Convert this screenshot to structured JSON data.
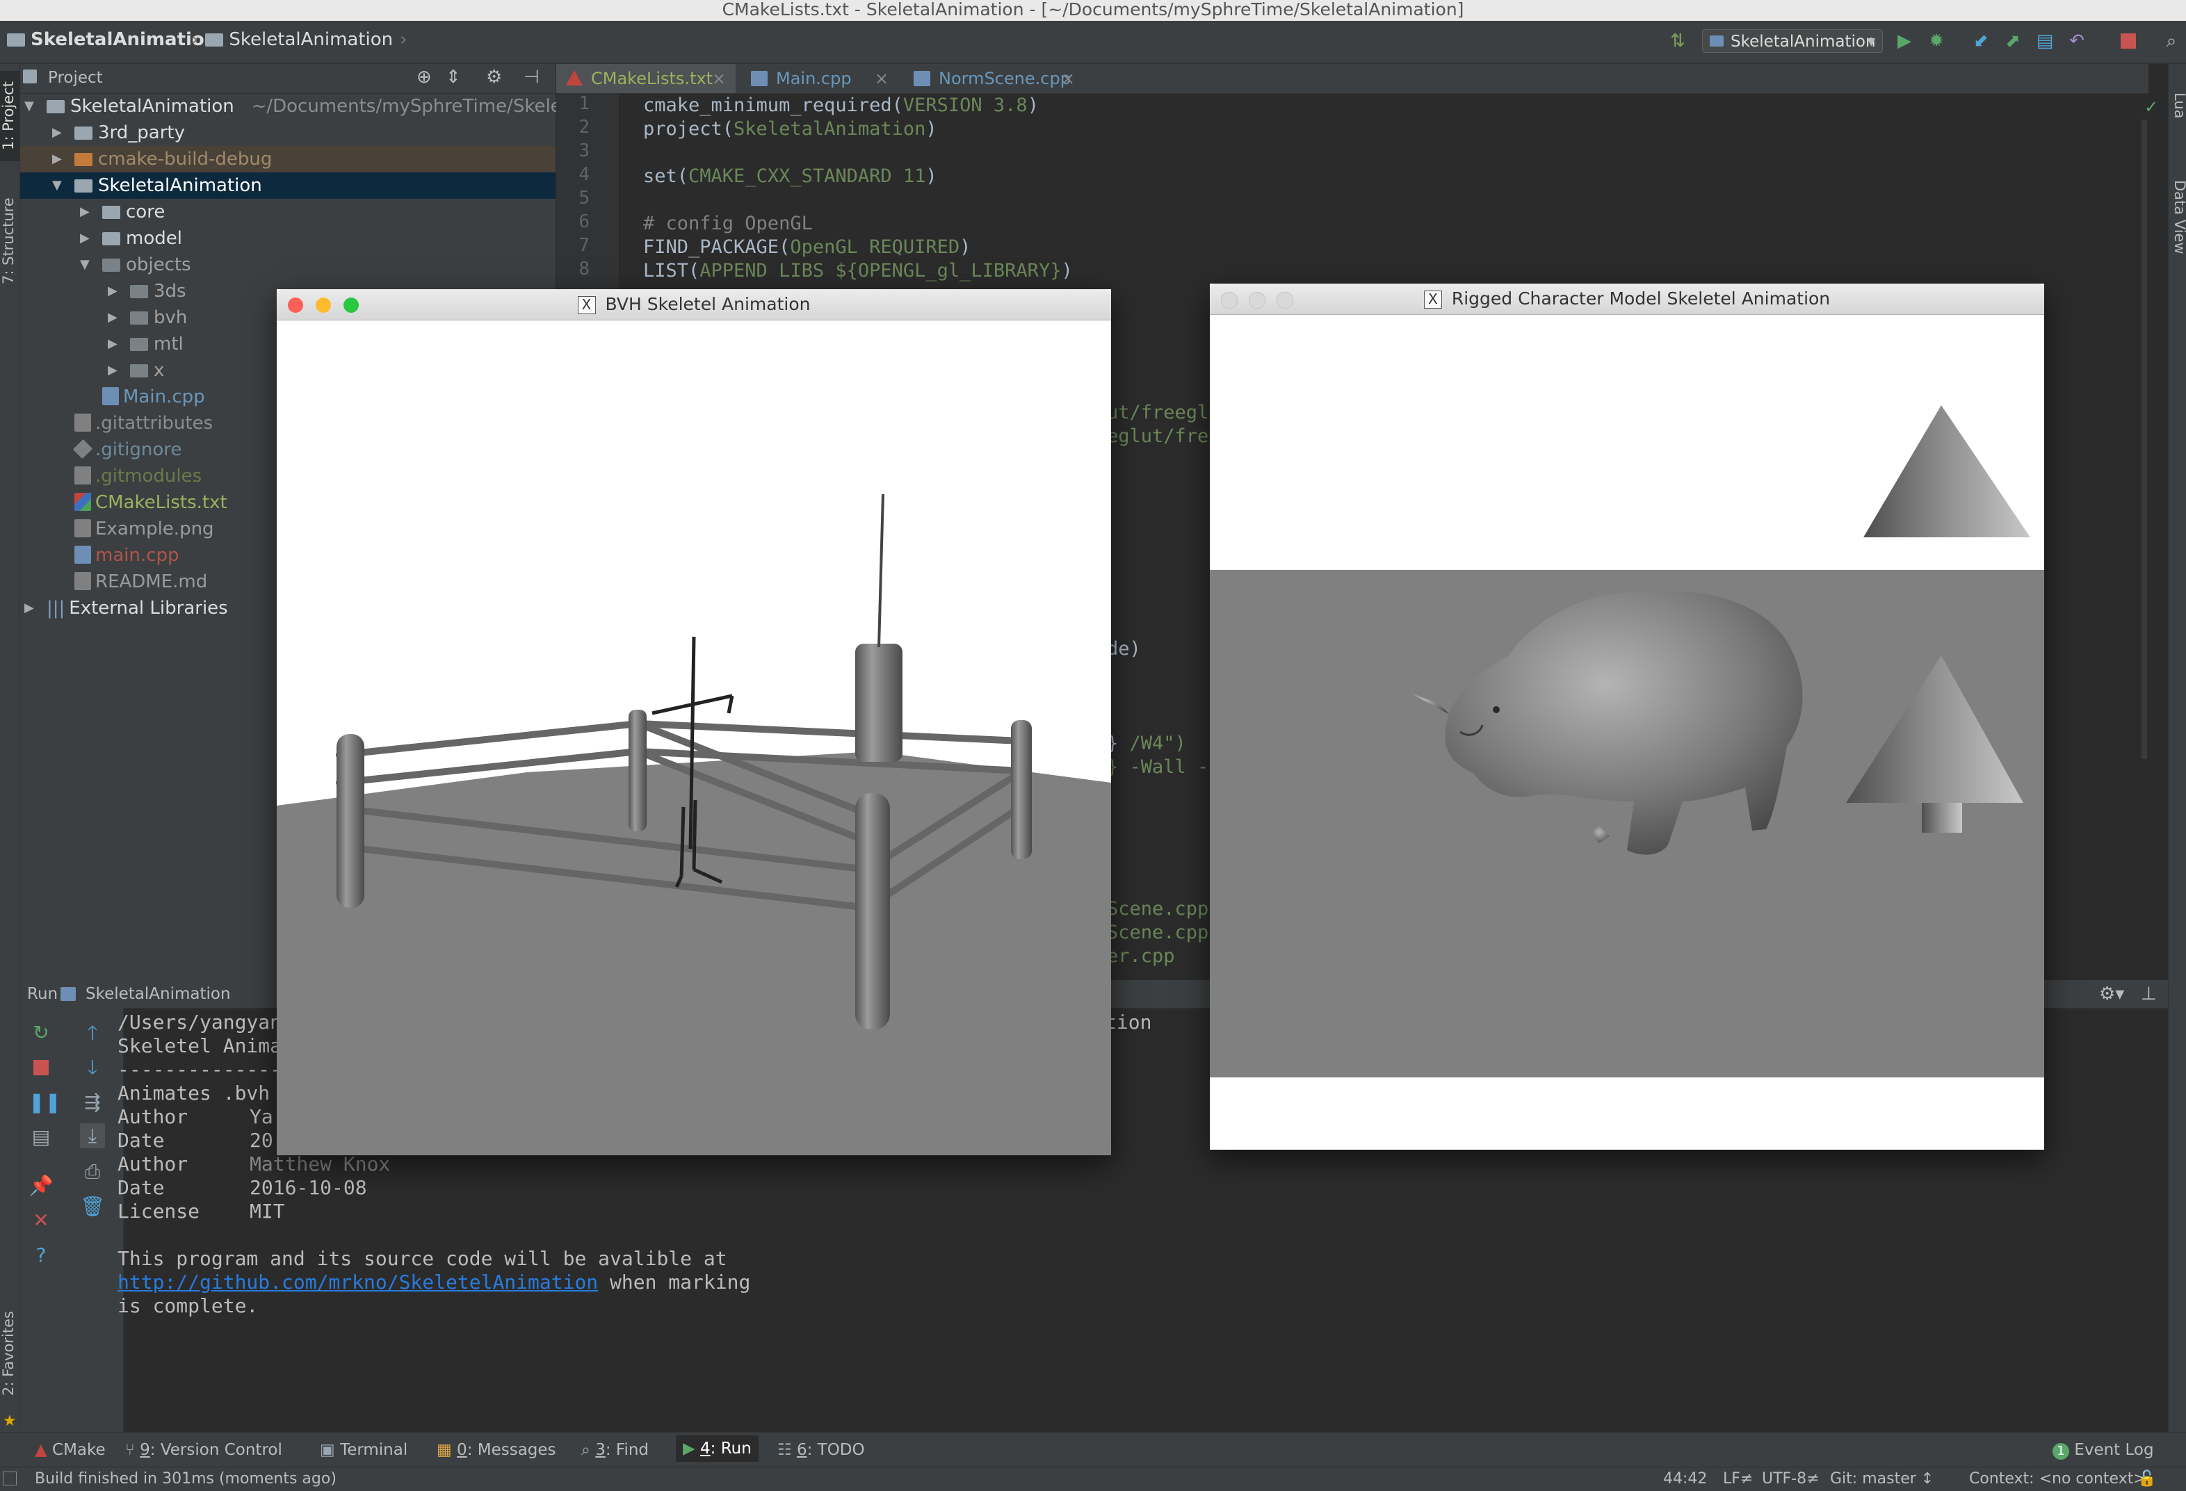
{
  "window": {
    "title": "CMakeLists.txt - SkeletalAnimation - [~/Documents/mySphreTime/SkeletalAnimation]"
  },
  "toolbar": {
    "breadcrumbs": [
      "SkeletalAnimation",
      "SkeletalAnimation"
    ],
    "run_config": "SkeletalAnimation"
  },
  "left_strip": {
    "project_tab": "1: Project",
    "structure_tab": "7: Structure",
    "favorites_tab": "2: Favorites"
  },
  "right_strip": {
    "lua_tab": "Lua",
    "dataview_tab": "Data View"
  },
  "project": {
    "header": "Project",
    "items": [
      {
        "label": "SkeletalAnimation",
        "path": "~/Documents/mySphreTime/Skeletal",
        "type": "folder",
        "expanded": true
      },
      {
        "label": "3rd_party",
        "type": "folder"
      },
      {
        "label": "cmake-build-debug",
        "type": "folder-excluded"
      },
      {
        "label": "SkeletalAnimation",
        "type": "folder",
        "expanded": true
      },
      {
        "label": "core",
        "type": "folder"
      },
      {
        "label": "model",
        "type": "folder"
      },
      {
        "label": "objects",
        "type": "folder",
        "expanded": true
      },
      {
        "label": "3ds",
        "type": "folder"
      },
      {
        "label": "bvh",
        "type": "folder"
      },
      {
        "label": "mtl",
        "type": "folder"
      },
      {
        "label": "x",
        "type": "folder"
      },
      {
        "label": "Main.cpp",
        "type": "cpp"
      },
      {
        "label": ".gitattributes",
        "type": "file"
      },
      {
        "label": ".gitignore",
        "type": "git"
      },
      {
        "label": ".gitmodules",
        "type": "file"
      },
      {
        "label": "CMakeLists.txt",
        "type": "cmake"
      },
      {
        "label": "Example.png",
        "type": "file"
      },
      {
        "label": "main.cpp",
        "type": "cpp-deleted"
      },
      {
        "label": "README.md",
        "type": "file"
      },
      {
        "label": "External Libraries",
        "type": "lib"
      }
    ]
  },
  "editor": {
    "tabs": [
      {
        "label": "CMakeLists.txt",
        "active": true
      },
      {
        "label": "Main.cpp",
        "active": false
      },
      {
        "label": "NormScene.cpp",
        "active": false
      }
    ],
    "line_numbers": [
      "1",
      "2",
      "3",
      "4",
      "5",
      "6",
      "7",
      "8"
    ],
    "lines": {
      "l1a": "cmake_minimum_required(",
      "l1b": "VERSION 3.8",
      "l1c": ")",
      "l2a": "project(",
      "l2b": "SkeletalAnimation",
      "l2c": ")",
      "l4a": "set(",
      "l4b": "CMAKE_CXX_STANDARD 11",
      "l4c": ")",
      "l6": "# config OpenGL",
      "l7a": "FIND_PACKAGE(",
      "l7b": "OpenGL REQUIRED",
      "l7c": ")",
      "l8a": "LIST(",
      "l8b": "APPEND LIBS ${OPENGL_gl_LIBRARY}",
      "l8c": ")"
    },
    "partial": {
      "p1": "ut/freegl",
      "p2": "eglut/fre",
      "p3": "de)",
      "p4a": "} ",
      "p4b": "/W4\")",
      "p5": "} -Wall -",
      "p6": "Scene.cpp",
      "p7": "Scene.cpp",
      "p8": "er.cpp"
    }
  },
  "run": {
    "header_label": "Run",
    "config_name": "SkeletalAnimation",
    "output": {
      "line1": "/Users/yangyan",
      "line1_tail": "tion",
      "line2": "Skeletel Animat",
      "sep": "----------------",
      "line3": "Animates .bvh ",
      "author1_label": "Author",
      "author1_value": "Ya",
      "date1_label": "Date",
      "date1_value": "20",
      "author2_label": "Author",
      "author2_value": "Matthew Knox",
      "date2_label": "Date",
      "date2_value": "2016-10-08",
      "license_label": "License",
      "license_value": "MIT",
      "avail_line": "This program and its source code will be avalible at",
      "link": "http://github.com/mrkno/SkeletelAnimation",
      "after_link": " when marking",
      "complete": "is complete."
    }
  },
  "bottom_tools": {
    "cmake": "CMake",
    "vcs_key": "9",
    "vcs": ": Version Control",
    "terminal": "Terminal",
    "messages_key": "0",
    "messages": ": Messages",
    "find_key": "3",
    "find": ": Find",
    "run_key": "4",
    "run": ": Run",
    "todo_key": "6",
    "todo": ": TODO",
    "event_log": "Event Log",
    "event_count": "1"
  },
  "status": {
    "message": "Build finished in 301ms (moments ago)",
    "position": "44:42",
    "line_sep": "LF≠",
    "encoding": "UTF-8≠",
    "git": "Git: master ↕",
    "context": "Context: <no context>"
  },
  "bvh_window": {
    "title": "BVH Skeletel Animation"
  },
  "rigged_window": {
    "title": "Rigged Character Model Skeletel Animation"
  },
  "colors": {
    "accent": "#0d293e",
    "keyword": "#cc7832",
    "string": "#6a8759",
    "comment": "#808080",
    "link": "#287bde"
  }
}
